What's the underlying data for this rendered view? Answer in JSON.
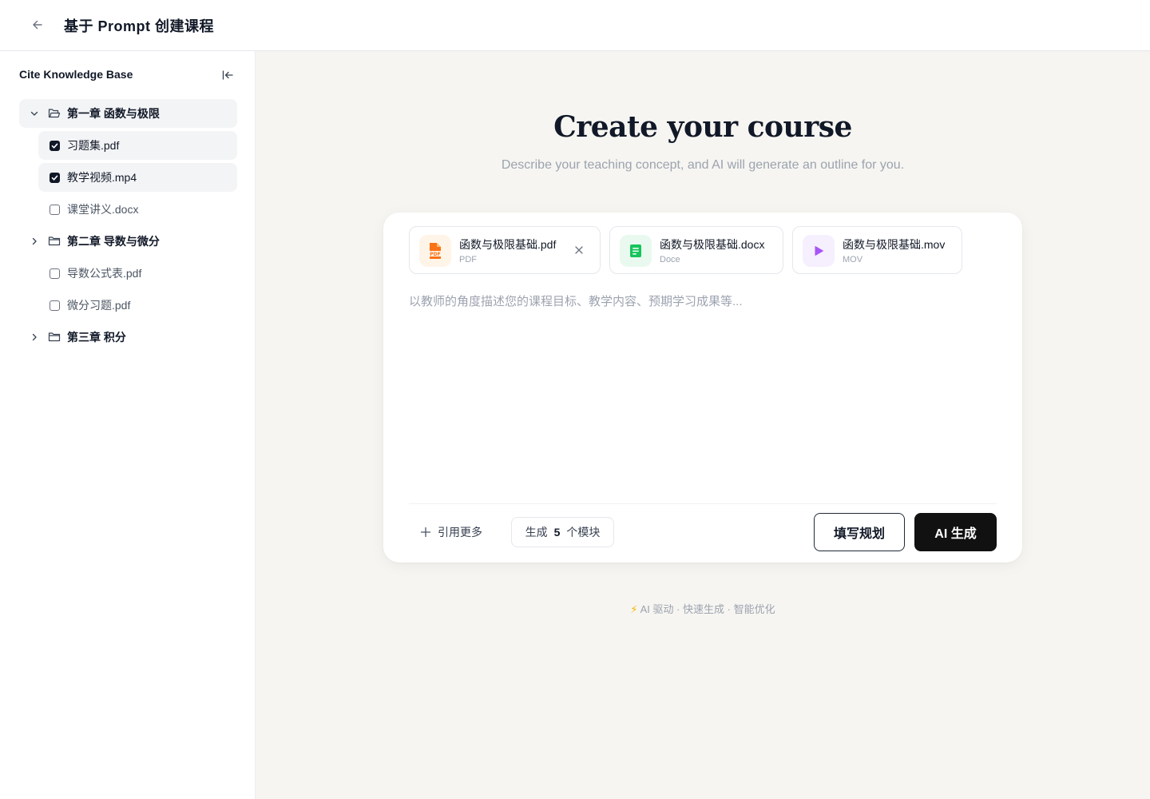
{
  "header": {
    "title": "基于 Prompt 创建课程"
  },
  "sidebar": {
    "title": "Cite Knowledge Base",
    "tree": [
      {
        "type": "folder",
        "label": "第一章 函数与极限",
        "expanded": true
      },
      {
        "type": "file",
        "label": "习题集.pdf",
        "checked": true
      },
      {
        "type": "file",
        "label": "教学视频.mp4",
        "checked": true
      },
      {
        "type": "file",
        "label": "课堂讲义.docx",
        "checked": false
      },
      {
        "type": "folder",
        "label": "第二章 导数与微分",
        "expanded": false
      },
      {
        "type": "file",
        "label": "导数公式表.pdf",
        "checked": false
      },
      {
        "type": "file",
        "label": "微分习题.pdf",
        "checked": false
      },
      {
        "type": "folder",
        "label": "第三章 积分",
        "expanded": false
      }
    ]
  },
  "main": {
    "title": "Create your course",
    "subtitle": "Describe your teaching concept, and AI will generate an outline for you.",
    "attachments": [
      {
        "name": "函数与极限基础.pdf",
        "type": "PDF",
        "icon": "pdf-file-icon",
        "color": "#f97316",
        "bg": "#fff4e8"
      },
      {
        "name": "函数与极限基础.docx",
        "type": "Doce",
        "icon": "doc-file-icon",
        "color": "#16c45b",
        "bg": "#e9f9ef"
      },
      {
        "name": "函数与极限基础.mov",
        "type": "MOV",
        "icon": "play-icon",
        "color": "#a855f7",
        "bg": "#f6effe"
      }
    ],
    "prompt": {
      "value": "",
      "placeholder": "以教师的角度描述您的课程目标、教学内容、预期学习成果等..."
    },
    "cite_more": "引用更多",
    "modules": {
      "prefix": "生成",
      "count": "5",
      "suffix": "个模块"
    },
    "plan_button": "填写规划",
    "ai_button": "AI 生成",
    "footer_note": "AI 驱动 · 快速生成 · 智能优化"
  }
}
